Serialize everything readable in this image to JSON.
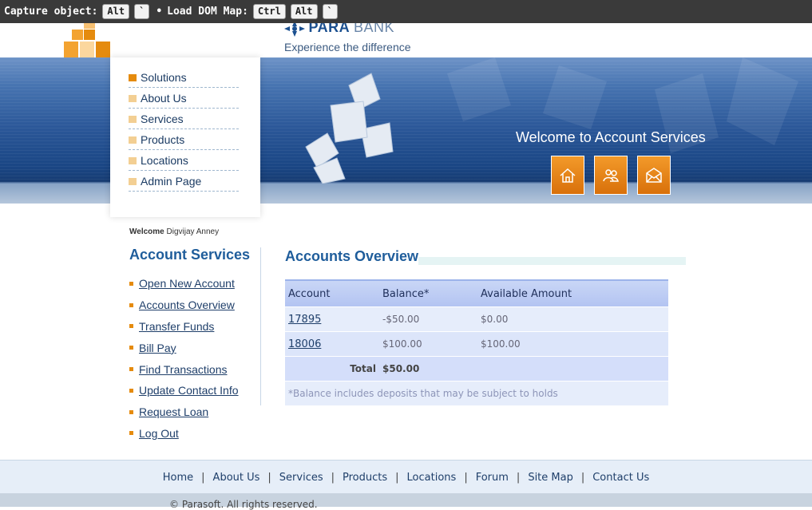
{
  "capture_bar": {
    "capture_label": "Capture object:",
    "capture_keys": [
      "Alt",
      "`"
    ],
    "bullet": "•",
    "dom_label": "Load DOM Map:",
    "dom_keys": [
      "Ctrl",
      "Alt",
      "`"
    ]
  },
  "header": {
    "brand_bold": "PARA",
    "brand_light": "BANK",
    "tagline": "Experience the difference",
    "welcome_banner": "Welcome to Account Services",
    "icon_buttons": [
      "home-icon",
      "contact-people-icon",
      "mail-icon"
    ],
    "colors": {
      "accent": "#e58b0e",
      "brand": "#1f5d9b",
      "banner": "#2a5697"
    }
  },
  "sidenav": {
    "items": [
      "Solutions",
      "About Us",
      "Services",
      "Products",
      "Locations",
      "Admin Page"
    ]
  },
  "left_panel": {
    "welcome_label": "Welcome",
    "user_name": "Digvijay Anney",
    "title": "Account Services",
    "links": [
      "Open New Account",
      "Accounts Overview",
      "Transfer Funds",
      "Bill Pay",
      "Find Transactions",
      "Update Contact Info",
      "Request Loan",
      "Log Out"
    ]
  },
  "main": {
    "title": "Accounts Overview",
    "table": {
      "headers": [
        "Account",
        "Balance*",
        "Available Amount"
      ],
      "rows": [
        {
          "account": "17895",
          "balance": "-$50.00",
          "available": "$0.00"
        },
        {
          "account": "18006",
          "balance": "$100.00",
          "available": "$100.00"
        }
      ],
      "total_label": "Total",
      "total_value": "$50.00",
      "note": "*Balance includes deposits that may be subject to holds"
    }
  },
  "footer": {
    "links": [
      "Home",
      "About Us",
      "Services",
      "Products",
      "Locations",
      "Forum",
      "Site Map",
      "Contact Us"
    ],
    "copyright": "© Parasoft. All rights reserved."
  }
}
